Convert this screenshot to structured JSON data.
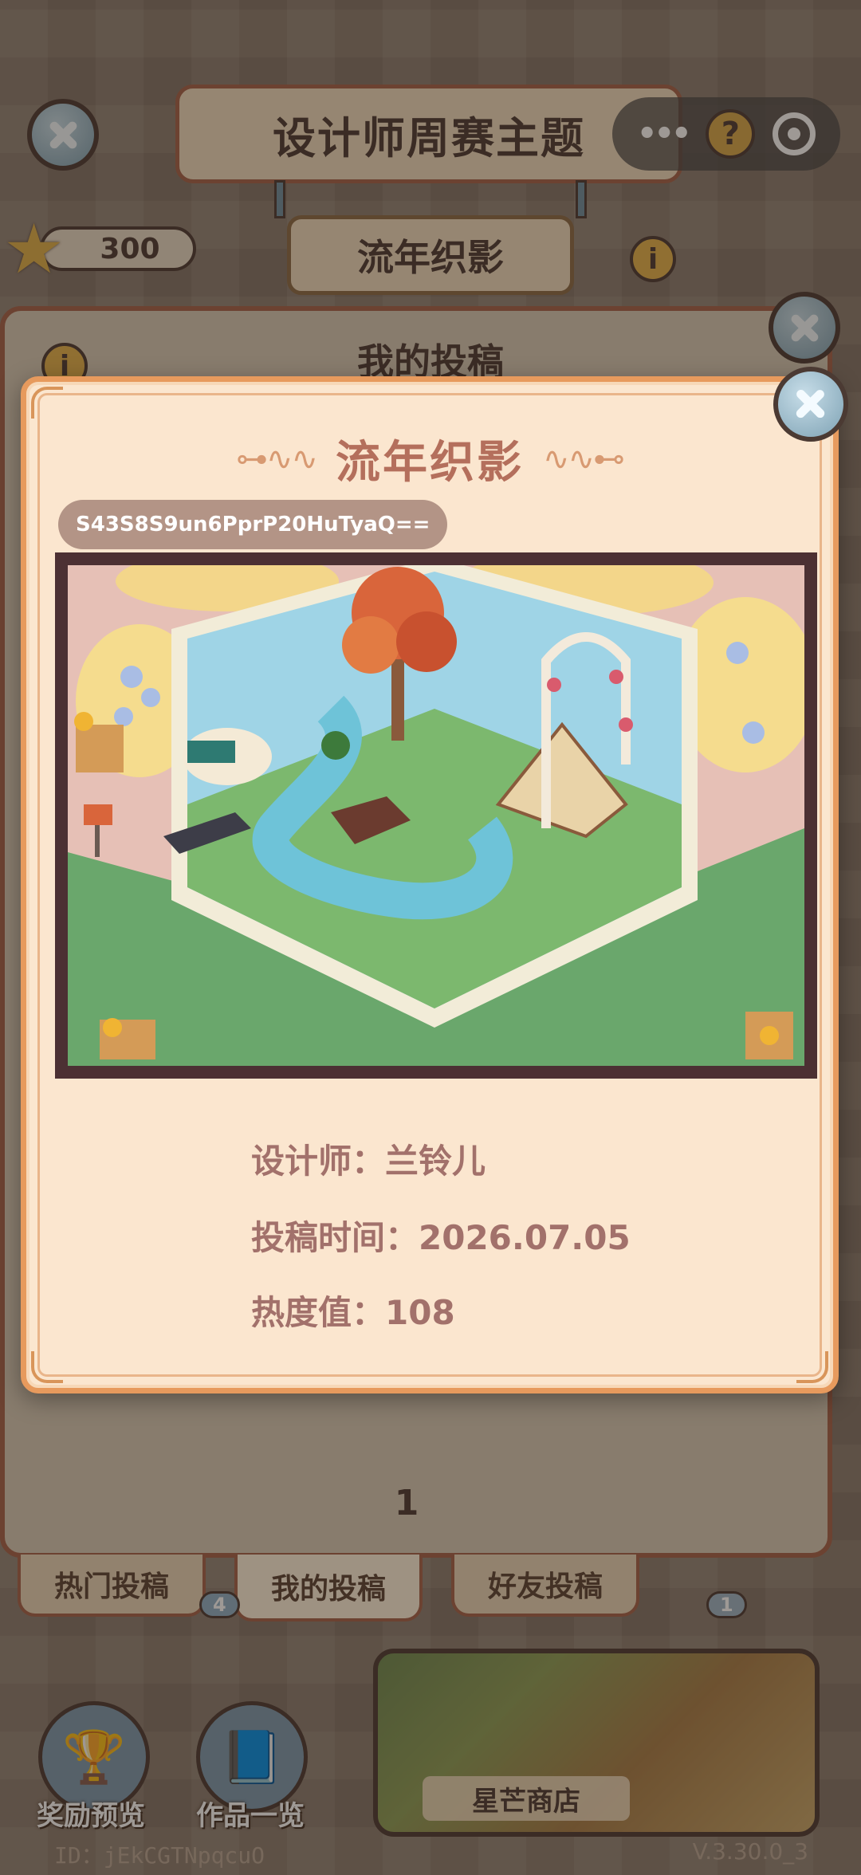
{
  "header": {
    "title": "设计师周赛主题",
    "theme_name": "流年织影",
    "star_count": "300",
    "info_glyph": "i",
    "help_glyph": "?"
  },
  "back_panel": {
    "title": "我的投稿",
    "page_number": "1"
  },
  "tabs": [
    {
      "label": "热门投稿"
    },
    {
      "label": "我的投稿"
    },
    {
      "label": "好友投稿"
    }
  ],
  "badges": {
    "left": "4",
    "right": "1"
  },
  "bottom": {
    "rewards_label": "奖励预览",
    "works_label": "作品一览",
    "shop_label": "星芒商店",
    "user_id": "ID：jEkCGTNpqcuO",
    "version": "V.3.30.0_3"
  },
  "modal": {
    "title": "流年织影",
    "share_code": "S43S8S9un6PprP20HuTyaQ==",
    "designer": "设计师：兰铃儿",
    "submit_date": "投稿时间：2026.07.05",
    "heat": "热度值：108"
  },
  "icons": {
    "close": "close-icon",
    "star": "star-icon",
    "info": "info-icon",
    "help": "help-icon",
    "more": "more-dots-icon",
    "target": "target-icon"
  },
  "colors": {
    "accent_orange": "#e79a5d",
    "title_brown": "#b46f5c",
    "meta_text": "#a2716b",
    "dark_outline": "#4b3a33"
  }
}
